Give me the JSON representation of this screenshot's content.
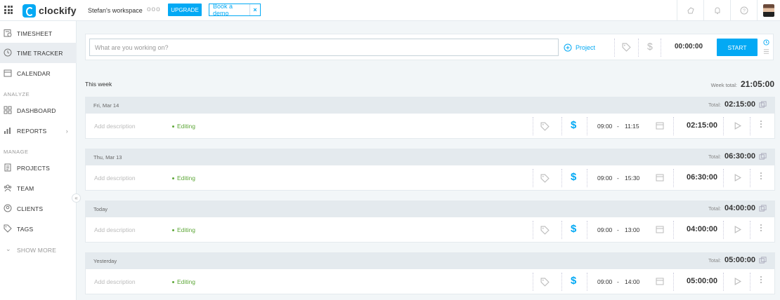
{
  "header": {
    "logo_text": "clockify",
    "workspace": "Stefan's workspace",
    "workspace_menu": "ooo",
    "upgrade_label": "UPGRADE",
    "demo_label": "Book a demo",
    "demo_close": "×",
    "icons": [
      "whats-new-icon",
      "bell-icon",
      "help-icon",
      "avatar"
    ]
  },
  "sidebar": {
    "items": [
      {
        "label": "TIMESHEET",
        "icon": "timesheet-icon"
      },
      {
        "label": "TIME TRACKER",
        "icon": "clock-icon"
      },
      {
        "label": "CALENDAR",
        "icon": "calendar-icon"
      }
    ],
    "analyze_label": "ANALYZE",
    "analyze_items": [
      {
        "label": "DASHBOARD",
        "icon": "dashboard-icon"
      },
      {
        "label": "REPORTS",
        "icon": "reports-icon"
      }
    ],
    "manage_label": "MANAGE",
    "manage_items": [
      {
        "label": "PROJECTS",
        "icon": "projects-icon"
      },
      {
        "label": "TEAM",
        "icon": "team-icon"
      },
      {
        "label": "CLIENTS",
        "icon": "clients-icon"
      },
      {
        "label": "TAGS",
        "icon": "tags-icon"
      }
    ],
    "show_more": "SHOW MORE",
    "collapse": "«",
    "reports_chevron": "›",
    "show_more_chevron": "⌄"
  },
  "tracker": {
    "placeholder": "What are you working on?",
    "project_label": "Project",
    "billable_symbol": "$",
    "timer": "00:00:00",
    "start_label": "START"
  },
  "week": {
    "title": "This week",
    "total_label": "Week total:",
    "total_value": "21:05:00"
  },
  "days": [
    {
      "date": "Fri, Mar 14",
      "total_label": "Total:",
      "total": "02:15:00",
      "entry": {
        "description": "Add description",
        "project": "Editing",
        "billable": "$",
        "start": "09:00",
        "dash": "-",
        "end": "11:15",
        "duration": "02:15:00"
      }
    },
    {
      "date": "Thu, Mar 13",
      "total_label": "Total:",
      "total": "06:30:00",
      "entry": {
        "description": "Add description",
        "project": "Editing",
        "billable": "$",
        "start": "09:00",
        "dash": "-",
        "end": "15:30",
        "duration": "06:30:00"
      }
    },
    {
      "date": "Today",
      "total_label": "Total:",
      "total": "04:00:00",
      "entry": {
        "description": "Add description",
        "project": "Editing",
        "billable": "$",
        "start": "09:00",
        "dash": "-",
        "end": "13:00",
        "duration": "04:00:00"
      }
    },
    {
      "date": "Yesterday",
      "total_label": "Total:",
      "total": "05:00:00",
      "entry": {
        "description": "Add description",
        "project": "Editing",
        "billable": "$",
        "start": "09:00",
        "dash": "-",
        "end": "14:00",
        "duration": "05:00:00"
      }
    }
  ],
  "colors": {
    "accent": "#03a9f4",
    "project": "#5fa83a",
    "background": "#f2f6f8",
    "day_header": "#e4eaee"
  }
}
